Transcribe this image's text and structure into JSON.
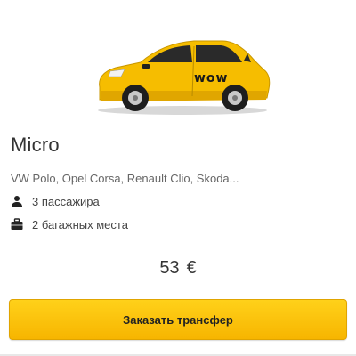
{
  "card": {
    "title": "Micro",
    "models": "VW Polo, Opel Corsa, Renault Clio, Skoda...",
    "car_decal": "wow",
    "features": [
      {
        "icon": "person-icon",
        "text": "3 пассажира"
      },
      {
        "icon": "suitcase-icon",
        "text": "2 багажных места"
      }
    ],
    "price": {
      "amount": "53",
      "currency": "€"
    },
    "order_button": "Заказать трансфер"
  },
  "colors": {
    "accent": "#f7b500",
    "car_body": "#f6bd00",
    "text": "#333333"
  }
}
